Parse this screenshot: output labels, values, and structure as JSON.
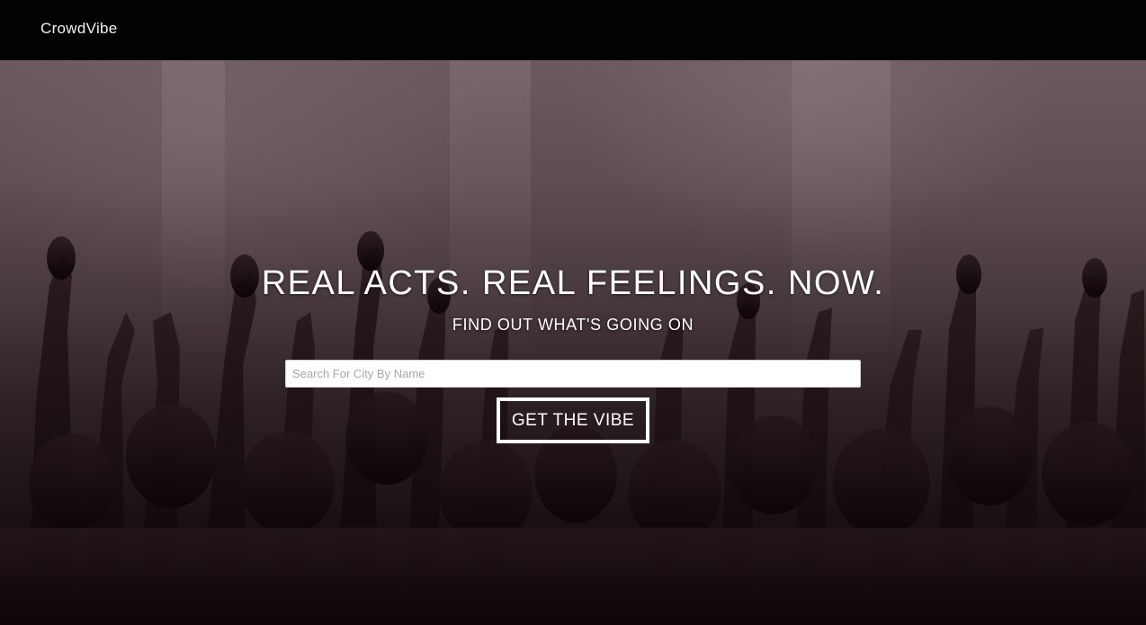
{
  "navbar": {
    "brand": "CrowdVibe"
  },
  "hero": {
    "headline": "REAL ACTS. REAL FEELINGS. NOW.",
    "subheadline": "FIND OUT WHAT'S GOING ON",
    "search": {
      "placeholder": "Search For City By Name",
      "value": ""
    },
    "cta_label": "GET THE VIBE",
    "background_image": "concert-crowd-raised-hands"
  },
  "colors": {
    "navbar_bg": "#020202",
    "text": "#ffffff",
    "overlay_tint": "#5d4d52"
  }
}
